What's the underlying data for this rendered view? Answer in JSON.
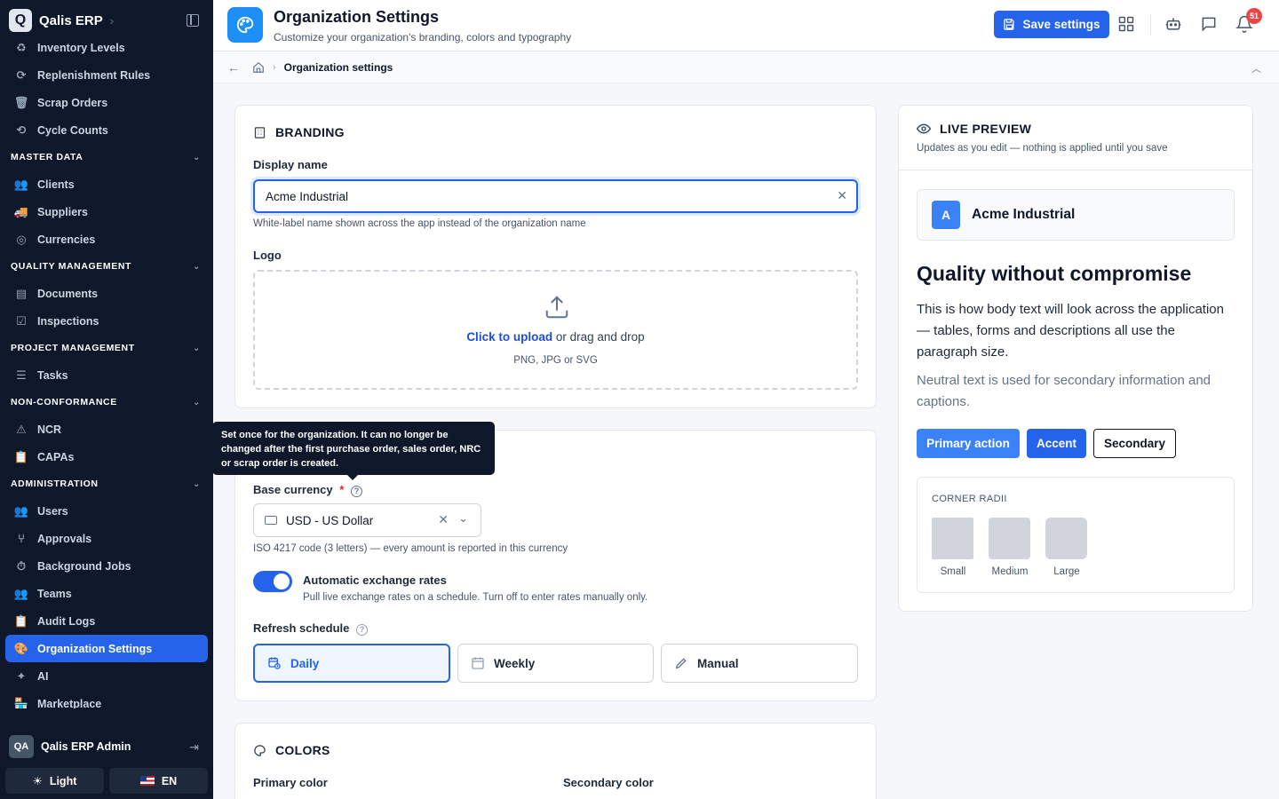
{
  "sidebar": {
    "brand": "Qalis ERP",
    "brand_logo_letter": "Q",
    "items_top": [
      {
        "label": "Inventory Levels",
        "icon": "recycle-icon"
      },
      {
        "label": "Replenishment Rules",
        "icon": "refresh-icon"
      },
      {
        "label": "Scrap Orders",
        "icon": "trash-icon"
      },
      {
        "label": "Cycle Counts",
        "icon": "refresh-icon"
      }
    ],
    "sections": [
      {
        "title": "MASTER DATA",
        "items": [
          "Clients",
          "Suppliers",
          "Currencies"
        ]
      },
      {
        "title": "QUALITY MANAGEMENT",
        "items": [
          "Documents",
          "Inspections"
        ]
      },
      {
        "title": "PROJECT MANAGEMENT",
        "items": [
          "Tasks"
        ]
      },
      {
        "title": "NON-CONFORMANCE",
        "items": [
          "NCR",
          "CAPAs"
        ]
      },
      {
        "title": "ADMINISTRATION",
        "items": [
          "Users",
          "Approvals",
          "Background Jobs",
          "Teams",
          "Audit Logs",
          "Organization Settings",
          "AI",
          "Marketplace"
        ]
      }
    ],
    "user_initials": "QA",
    "user_name": "Qalis ERP Admin",
    "theme_label": "Light",
    "lang_label": "EN"
  },
  "header": {
    "title": "Organization Settings",
    "subtitle": "Customize your organization's branding, colors and typography",
    "save_label": "Save settings",
    "notif_count": "51"
  },
  "breadcrumb": {
    "current": "Organization settings"
  },
  "branding": {
    "heading": "BRANDING",
    "display_name_label": "Display name",
    "display_name_value": "Acme Industrial",
    "display_name_help": "White-label name shown across the app instead of the organization name",
    "logo_label": "Logo",
    "upload_link": "Click to upload",
    "upload_rest": "or drag and drop",
    "upload_types": "PNG, JPG or SVG"
  },
  "currency": {
    "tooltip": "Set once for the organization. It can no longer be changed after the first purchase order, sales order, NRC or scrap order is created.",
    "base_label": "Base currency",
    "required_mark": "*",
    "base_value": "USD - US Dollar",
    "base_help": "ISO 4217 code (3 letters) — every amount is reported in this currency",
    "auto_label": "Automatic exchange rates",
    "auto_help": "Pull live exchange rates on a schedule. Turn off to enter rates manually only.",
    "auto_on": true,
    "schedule_label": "Refresh schedule",
    "schedule_options": [
      "Daily",
      "Weekly",
      "Manual"
    ],
    "schedule_selected": "Daily"
  },
  "colors": {
    "heading": "COLORS",
    "primary_label": "Primary color",
    "secondary_label": "Secondary color"
  },
  "preview": {
    "heading": "LIVE PREVIEW",
    "subtitle": "Updates as you edit — nothing is applied until you save",
    "logo_letter": "A",
    "brand_name": "Acme Industrial",
    "heading_text": "Quality without compromise",
    "body_text": "This is how body text will look across the application — tables, forms and descriptions all use the paragraph size.",
    "muted_text": "Neutral text is used for secondary information and captions.",
    "btn_primary": "Primary action",
    "btn_accent": "Accent",
    "btn_secondary": "Secondary",
    "radii_title": "CORNER RADII",
    "radii": [
      "Small",
      "Medium",
      "Large"
    ]
  },
  "colors_theme": {
    "primary": "#3b82f6",
    "accent": "#2563eb",
    "sidebar_bg": "#0f172a"
  }
}
